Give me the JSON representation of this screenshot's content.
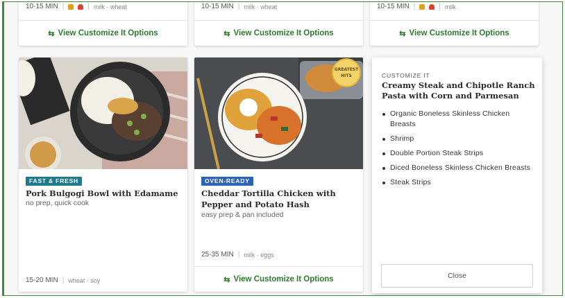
{
  "top_row": [
    {
      "time": "10-15 MIN",
      "tags": "milk · wheat",
      "cta": "View Customize It Options",
      "show_icons": true
    },
    {
      "time": "10-15 MIN",
      "tags": "milk · wheat",
      "cta": "View Customize It Options",
      "show_icons": false
    },
    {
      "time": "10-15 MIN",
      "tags": "milk",
      "cta": "View Customize It Options",
      "show_icons": true
    }
  ],
  "cards": [
    {
      "badge": "FAST & FRESH",
      "badge_color": "#1e7a8c",
      "title": "Pork Bulgogi Bowl with Edamame",
      "subtitle": "no prep, quick cook",
      "time": "15-20 MIN",
      "tags": "wheat · soy"
    },
    {
      "badge": "OVEN-READY",
      "badge_color": "#2a63b8",
      "title": "Cheddar Tortilla Chicken with Pepper and Potato Hash",
      "subtitle": "easy prep & pan included",
      "time": "25-35 MIN",
      "tags": "milk · eggs",
      "cta": "View Customize It Options",
      "seal": "GREATEST HITS"
    }
  ],
  "customize_panel": {
    "label": "CUSTOMIZE IT",
    "title": "Creamy Steak and Chipotle Ranch Pasta with Corn and Parmesan",
    "options": [
      "Organic Boneless Skinless Chicken Breasts",
      "Shrimp",
      "Double Portion Steak Strips",
      "Diced Boneless Skinless Chicken Breasts",
      "Steak Strips"
    ],
    "close_label": "Close"
  },
  "colors": {
    "accent_green": "#2f7a2f",
    "frame_green": "#3d8a3d"
  }
}
